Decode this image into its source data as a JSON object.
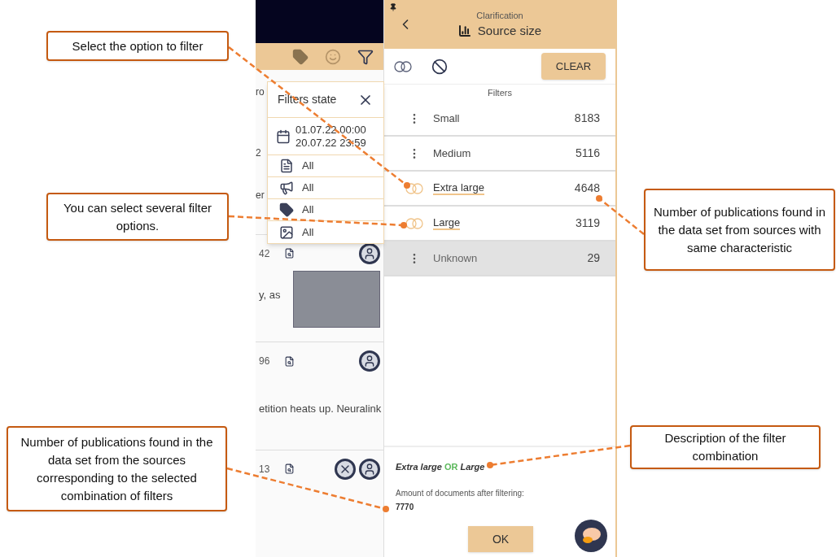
{
  "callouts": [
    {
      "text": "Select the option to filter"
    },
    {
      "text": "You can select several filter options."
    },
    {
      "text": "Number of publications found in the data set from sources with same characteristic"
    },
    {
      "text": "Number of publications found in the data set from the sources corresponding to the selected combination of filters"
    },
    {
      "text": "Description of the filter combination"
    }
  ],
  "feed": {
    "fragments": [
      "ro",
      "2",
      "er"
    ],
    "items": [
      {
        "count": "42",
        "text": "y, as",
        "has_image": true,
        "avatars": [
          {
            "kind": "person"
          }
        ]
      },
      {
        "count": "96",
        "text": "etition heats up. Neuralink",
        "has_image": false,
        "avatars": [
          {
            "kind": "person"
          }
        ]
      },
      {
        "count": "13",
        "has_image": false,
        "avatars": [
          {
            "kind": "logo"
          },
          {
            "kind": "person"
          }
        ]
      }
    ]
  },
  "filters_state": {
    "title": "Filters state",
    "date_from": "01.07.22 00:00",
    "date_to": "20.07.22 23:59",
    "rows": [
      {
        "kind": "document",
        "value": "All"
      },
      {
        "kind": "megaphone",
        "value": "All"
      },
      {
        "kind": "tag",
        "value": "All"
      },
      {
        "kind": "image",
        "value": "All"
      }
    ]
  },
  "panel": {
    "subtitle": "Clarification",
    "title": "Source size",
    "clear": "CLEAR",
    "section": "Filters",
    "options": [
      {
        "label": "Small",
        "count": "8183",
        "selected": false,
        "greyed": false
      },
      {
        "label": "Medium",
        "count": "5116",
        "selected": false,
        "greyed": false
      },
      {
        "label": "Extra large",
        "count": "4648",
        "selected": true,
        "greyed": false
      },
      {
        "label": "Large",
        "count": "3119",
        "selected": true,
        "greyed": false
      },
      {
        "label": "Unknown",
        "count": "29",
        "selected": false,
        "greyed": true
      }
    ],
    "combination": {
      "terms": [
        "Extra large",
        "Large"
      ],
      "operator": "OR"
    },
    "amount_label": "Amount of documents after filtering:",
    "amount": "7770",
    "ok": "OK"
  }
}
